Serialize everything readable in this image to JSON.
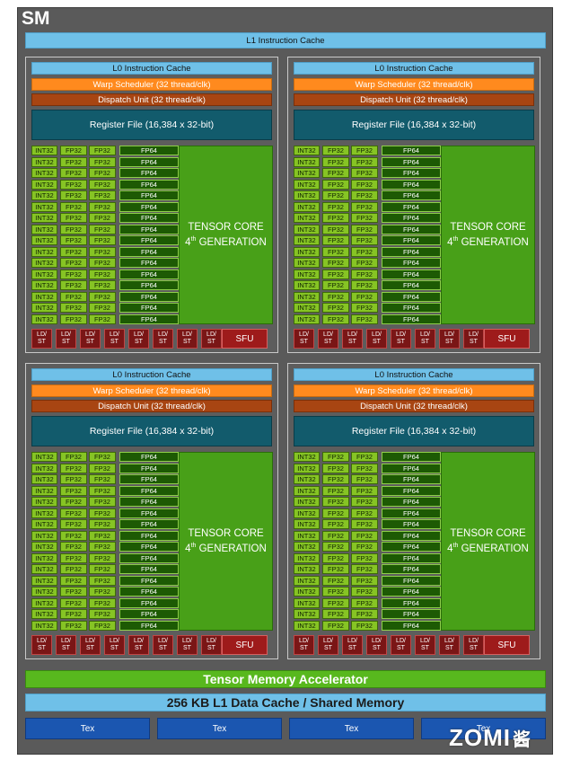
{
  "sm": {
    "title": "SM",
    "l1_instruction_cache": "L1 Instruction Cache",
    "tensor_memory_accelerator": "Tensor Memory Accelerator",
    "l1_data_cache": "256 KB L1 Data Cache / Shared Memory",
    "tex_units": [
      "Tex",
      "Tex",
      "Tex",
      "Tex"
    ]
  },
  "processing_block": {
    "l0_cache": "L0 Instruction Cache",
    "warp_scheduler": "Warp Scheduler (32 thread/clk)",
    "dispatch_unit": "Dispatch Unit (32 thread/clk)",
    "register_file": "Register File (16,384 x 32-bit)",
    "int32_label": "INT32",
    "fp32_label": "FP32",
    "fp64_label": "FP64",
    "core_rows": 16,
    "tensor_core_line1": "TENSOR CORE",
    "tensor_core_gen_number": "4",
    "tensor_core_gen_suffix": "th",
    "tensor_core_line2": " GENERATION",
    "ldst_top": "LD/",
    "ldst_bottom": "ST",
    "ldst_count": 8,
    "sfu_label": "SFU"
  },
  "watermark": {
    "text": "ZOMI",
    "suffix": "酱"
  },
  "colors": {
    "sm_background": "#5a5a5a",
    "cache_blue": "#6fc0e8",
    "warp_orange": "#ff8a1e",
    "dispatch_brown": "#a84512",
    "register_teal": "#125b6c",
    "core_green": "#86c424",
    "fp64_dark_green": "#1d5a04",
    "tensor_green": "#48a018",
    "ldst_red": "#7a1616",
    "tex_blue": "#1b56b0"
  }
}
